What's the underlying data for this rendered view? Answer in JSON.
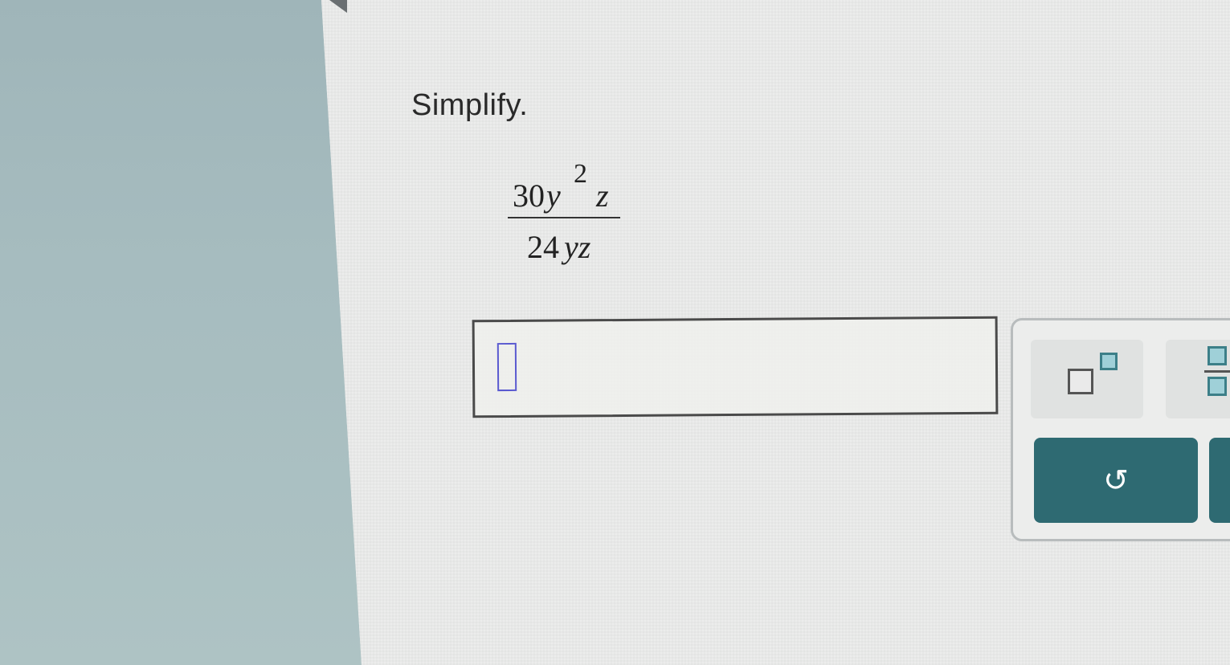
{
  "question": {
    "instruction": "Simplify.",
    "expression": {
      "numerator": {
        "coefficient": "30",
        "variable_1": "y",
        "exponent": "2",
        "variable_2": "z"
      },
      "denominator": {
        "coefficient": "24",
        "variables": "yz"
      }
    }
  },
  "answer": {
    "value": "",
    "placeholder": ""
  },
  "toolbar": {
    "exponent_icon": "superscript-template-icon",
    "fraction_icon": "fraction-template-icon",
    "undo_glyph": "↺",
    "undo_icon": "undo-icon"
  },
  "colors": {
    "accent": "#2e6a72",
    "slot_fill": "#9fd0d8",
    "cursor": "#5a5ad0"
  }
}
